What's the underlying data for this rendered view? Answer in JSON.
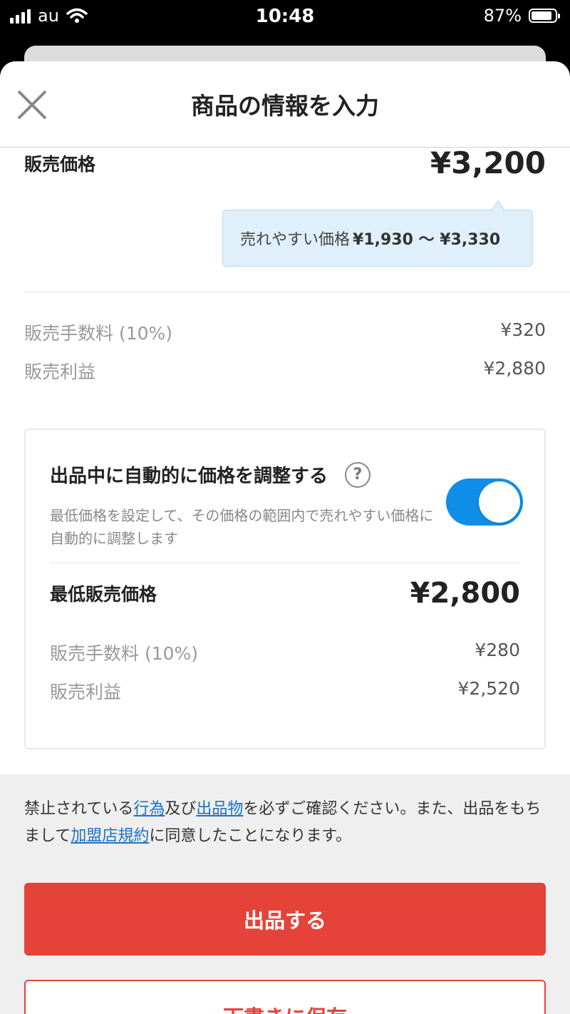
{
  "status_bar": {
    "carrier": "au",
    "time": "10:48",
    "battery_percent": "87%",
    "battery_level": 0.87
  },
  "header": {
    "title": "商品の情報を入力",
    "close_icon": "close-icon"
  },
  "price": {
    "label": "販売価格",
    "value": "¥3,200",
    "suggestion_label": "売れやすい価格",
    "suggestion_range": "¥1,930 〜 ¥3,330",
    "fee_label": "販売手数料 (10%)",
    "fee_value": "¥320",
    "profit_label": "販売利益",
    "profit_value": "¥2,880"
  },
  "auto_adjust": {
    "title": "出品中に自動的に価格を調整する",
    "help_icon": "question-circle-icon",
    "description": "最低価格を設定して、その価格の範囲内で売れやすい価格に自動的に調整します",
    "toggle_on": true,
    "min_price_label": "最低販売価格",
    "min_price_value": "¥2,800",
    "fee_label": "販売手数料 (10%)",
    "fee_value": "¥280",
    "profit_label": "販売利益",
    "profit_value": "¥2,520"
  },
  "notice": {
    "part1": "禁止されている",
    "link_actions": "行為",
    "part2": "及び",
    "link_items": "出品物",
    "part3": "を必ずご確認ください。また、出品をもちまして",
    "link_terms": "加盟店規約",
    "part4": "に同意したことになります。"
  },
  "actions": {
    "submit_label": "出品する",
    "draft_label": "下書きに保存"
  },
  "colors": {
    "accent_red": "#e5433a",
    "toggle_blue": "#0e8ee8",
    "link_blue": "#1a73c8",
    "tooltip_bg": "#dff0fb"
  }
}
